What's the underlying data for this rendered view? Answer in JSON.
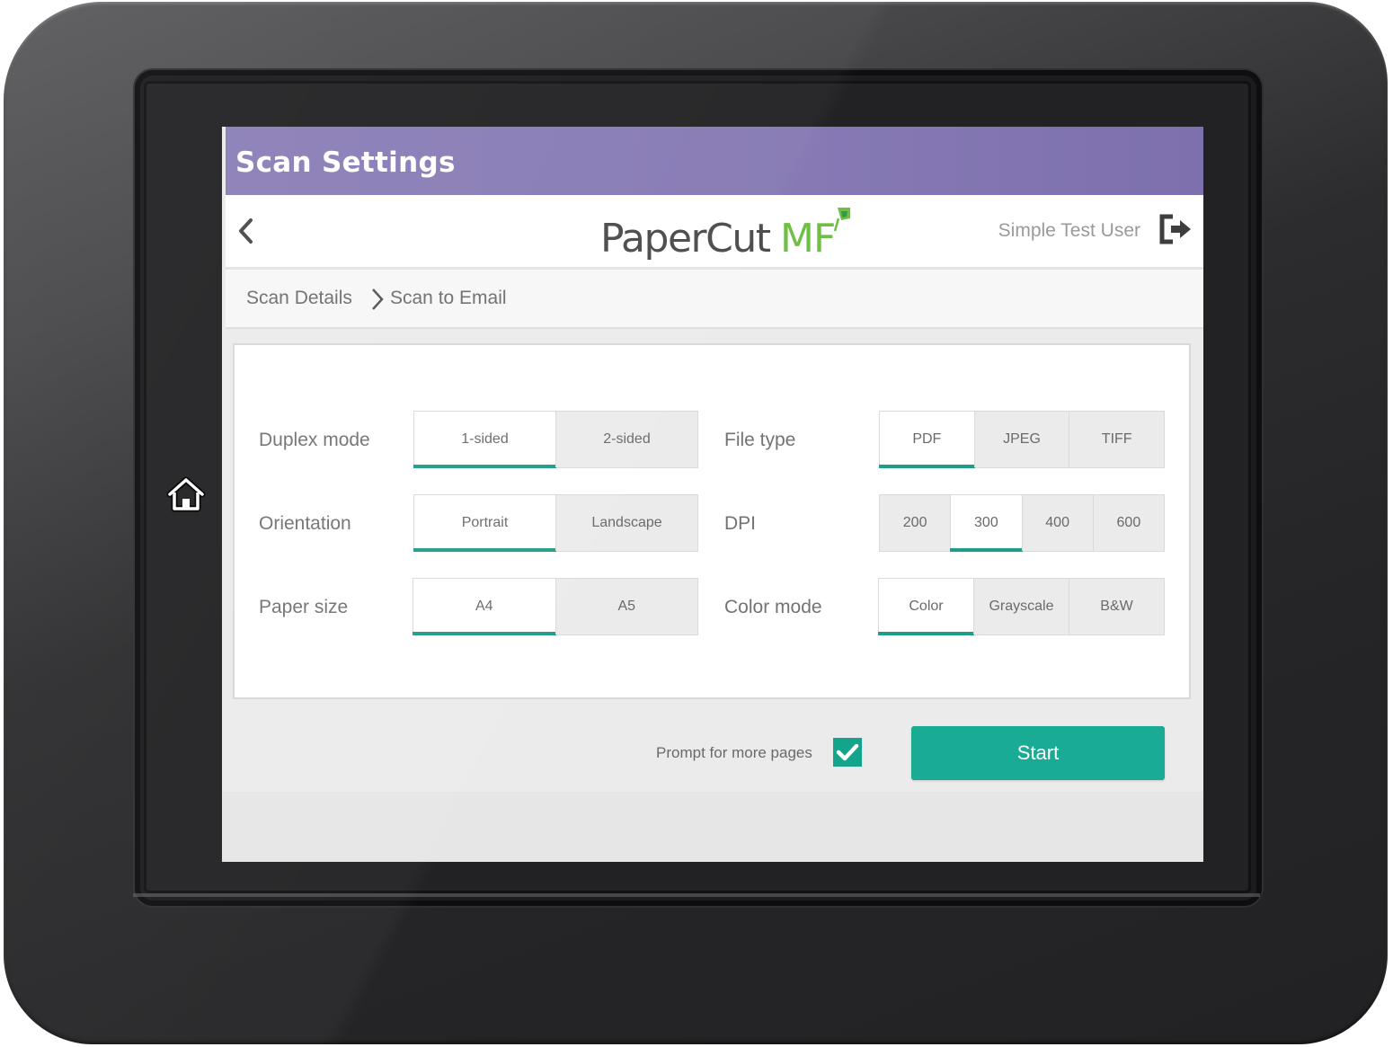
{
  "titlebar": {
    "title": "Scan Settings"
  },
  "header": {
    "logo_text": "PaperCut",
    "logo_suffix": "MF",
    "user_name": "Simple Test User",
    "icons": {
      "back": "chevron-left-icon",
      "logout": "logout-icon",
      "home": "home-icon"
    }
  },
  "breadcrumb": {
    "items": [
      "Scan Details",
      "Scan to Email"
    ]
  },
  "settings": {
    "duplex": {
      "label": "Duplex mode",
      "options": [
        "1-sided",
        "2-sided"
      ],
      "selected": "1-sided"
    },
    "orientation": {
      "label": "Orientation",
      "options": [
        "Portrait",
        "Landscape"
      ],
      "selected": "Portrait"
    },
    "paper_size": {
      "label": "Paper size",
      "options": [
        "A4",
        "A5"
      ],
      "selected": "A4"
    },
    "file_type": {
      "label": "File type",
      "options": [
        "PDF",
        "JPEG",
        "TIFF"
      ],
      "selected": "PDF"
    },
    "dpi": {
      "label": "DPI",
      "options": [
        "200",
        "300",
        "400",
        "600"
      ],
      "selected": "300"
    },
    "color_mode": {
      "label": "Color mode",
      "options": [
        "Color",
        "Grayscale",
        "B&W"
      ],
      "selected": "Color"
    }
  },
  "footer": {
    "prompt_label": "Prompt for more pages",
    "prompt_checked": true,
    "start_label": "Start"
  },
  "colors": {
    "titlebar": "#8679b4",
    "accent": "#1e9e88",
    "start_button": "#19ab93",
    "logo_green": "#6fbf45"
  }
}
